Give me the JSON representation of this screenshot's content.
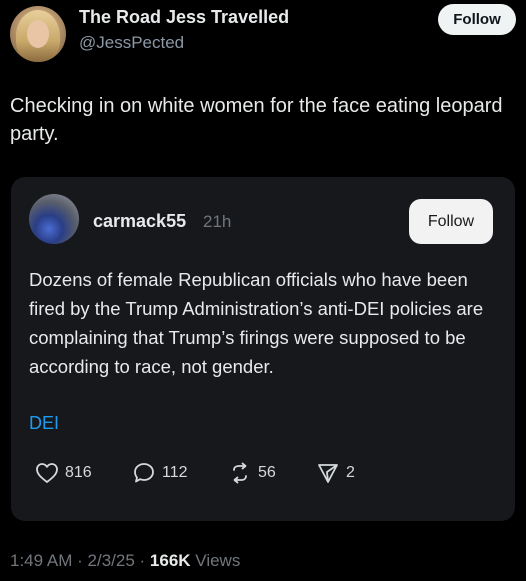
{
  "post": {
    "author": {
      "display_name": "The Road Jess Travelled",
      "handle": "@JessPected",
      "follow_label": "Follow"
    },
    "text": "Checking in on white women for the face eating leopard party.",
    "quote": {
      "author": "carmack55",
      "time": "21h",
      "follow_label": "Follow",
      "text": "Dozens of female Republican officials who have been fired by the Trump Administration’s anti-DEI policies are complaining that Trump’s firings were supposed to be according to race, not gender.",
      "tag": "DEI",
      "stats": {
        "likes": "816",
        "replies": "112",
        "reposts": "56",
        "shares": "2"
      }
    },
    "meta": {
      "time": "1:49 AM",
      "sep1": "·",
      "date": "2/3/25",
      "sep2": "·",
      "views": "166K",
      "views_label": "Views"
    }
  },
  "colors": {
    "background": "#000000",
    "text_primary": "#e7e9ea",
    "text_secondary": "#71767b",
    "card_background": "#16181c",
    "link": "#1d9bf0",
    "follow_button": "#eff3f4"
  },
  "icons": [
    "heart-icon",
    "comment-icon",
    "repost-icon",
    "share-icon"
  ]
}
